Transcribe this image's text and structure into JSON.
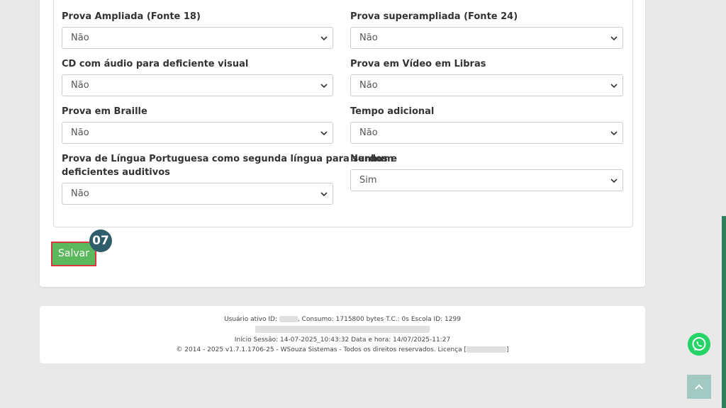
{
  "form": {
    "fields": [
      {
        "label": "Prova Ampliada (Fonte 18)",
        "value": "Não"
      },
      {
        "label": "Prova superampliada (Fonte 24)",
        "value": "Não"
      },
      {
        "label": "CD com áudio para deficiente visual",
        "value": "Não"
      },
      {
        "label": "Prova em Vídeo em Libras",
        "value": "Não"
      },
      {
        "label": "Prova em Braille",
        "value": "Não"
      },
      {
        "label": "Tempo adicional",
        "value": "Não"
      },
      {
        "label": "Prova de Língua Portuguesa como segunda língua para surdos e",
        "label2": "deficientes auditivos",
        "value": "Não"
      },
      {
        "label": "Nenhum",
        "value": "Sim"
      }
    ]
  },
  "actions": {
    "save_label": "Salvar",
    "step_badge": "07"
  },
  "footer": {
    "line1_prefix": "Usuário ativo ID:",
    "line1_suffix": ", Consumo: 1715800 bytes T.C.: 0s Escola ID: 1299",
    "line3": "Início Sessão: 14-07-2025_10:43:32 Data e hora: 14/07/2025-11:27",
    "line4_prefix": "© 2014 - 2025 v1.7.1.1706-25 - WSouza Sistemas - Todos os direitos reservados. Licença [",
    "line4_suffix": "]"
  },
  "colors": {
    "save_button": "#5cb85c",
    "highlight_border": "#d9363e",
    "badge": "#2f5d6b",
    "whatsapp": "#25d366",
    "scroll_top": "#a3c9c3"
  },
  "icons": {
    "select_arrow": "chevron-down-icon",
    "whatsapp": "whatsapp-icon",
    "scroll_top": "chevron-up-icon"
  }
}
